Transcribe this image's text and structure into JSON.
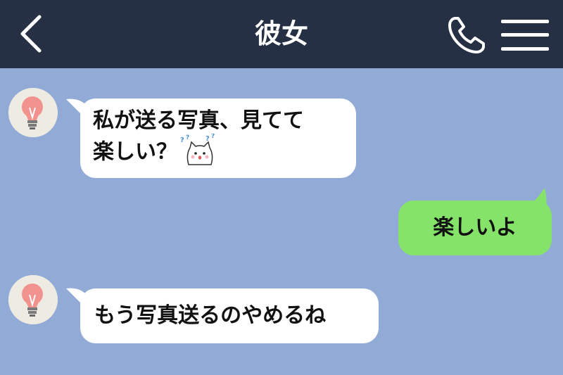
{
  "header": {
    "title": "彼女",
    "back_icon": "chevron-left-icon",
    "call_icon": "phone-icon",
    "menu_icon": "hamburger-menu-icon",
    "background": "#263045"
  },
  "chat": {
    "background": "#92abd6",
    "messages": [
      {
        "sender": "partner",
        "lines": [
          "私が送る写真、見てて",
          "楽しい？"
        ],
        "sticker": "confused-cat-emoji"
      },
      {
        "sender": "me",
        "text": "楽しいよ",
        "bubble_color": "#86e36a"
      },
      {
        "sender": "partner",
        "text": "もう写真送るのやめるね"
      }
    ],
    "avatar_icon": "light-bulb-icon"
  }
}
